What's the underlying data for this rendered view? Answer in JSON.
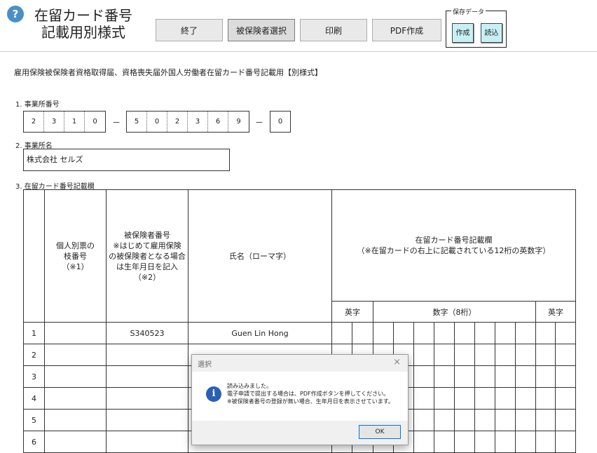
{
  "header": {
    "help_icon": "?",
    "title_line1": "在留カード番号",
    "title_line2": "記載用別様式",
    "buttons": {
      "exit": "終了",
      "select_insured": "被保険者選択",
      "print": "印刷",
      "pdf": "PDF作成"
    },
    "save_group": {
      "label": "保存データ",
      "create": "作成",
      "load": "読込"
    }
  },
  "form": {
    "subtitle": "雇用保険被保険者資格取得届、資格喪失届外国人労働者在留カード番号記載用【別様式】",
    "office_number_label": "1. 事業所番号",
    "office_number": {
      "part1": [
        "2",
        "3",
        "1",
        "0"
      ],
      "part2": [
        "5",
        "0",
        "2",
        "3",
        "6",
        "9"
      ],
      "part3": [
        "0"
      ],
      "dash": "－"
    },
    "office_name_label": "2. 事業所名",
    "office_name": "株式会社 セルズ",
    "residence_card_label": "3. 在留カード番号記載欄",
    "table": {
      "col_ledger": "個人別票の\n枝番号\n（※1）",
      "col_insured": "被保険者番号\n※はじめて雇用保険\nの被保険者となる場合\nは生年月日を記入\n（※2）",
      "col_name": "氏名（ローマ字）",
      "col_card": "在留カード番号記載欄\n（※在留カードの右上に記載されている12桁の英数字）",
      "sub_alpha1": "英字",
      "sub_digits": "数字（8桁）",
      "sub_alpha2": "英字",
      "rows": [
        {
          "no": "1",
          "insured": "S340523",
          "name": "Guen Lin Hong"
        },
        {
          "no": "2",
          "insured": "",
          "name": ""
        },
        {
          "no": "3",
          "insured": "",
          "name": ""
        },
        {
          "no": "4",
          "insured": "",
          "name": ""
        },
        {
          "no": "5",
          "insured": "",
          "name": ""
        },
        {
          "no": "6",
          "insured": "",
          "name": ""
        }
      ]
    }
  },
  "dialog": {
    "title": "選択",
    "close": "×",
    "icon": "i",
    "message": "読み込みました。\n電子申請で提出する場合は、PDF作成ボタンを押してください。\n※被保険者番号の登録が無い場合、生年月日を表示させています。",
    "ok": "OK"
  },
  "colors": {
    "save_button_bg": "#c7f0f5",
    "info_icon": "#2a5fb5",
    "help_icon": "#4a90c8"
  }
}
